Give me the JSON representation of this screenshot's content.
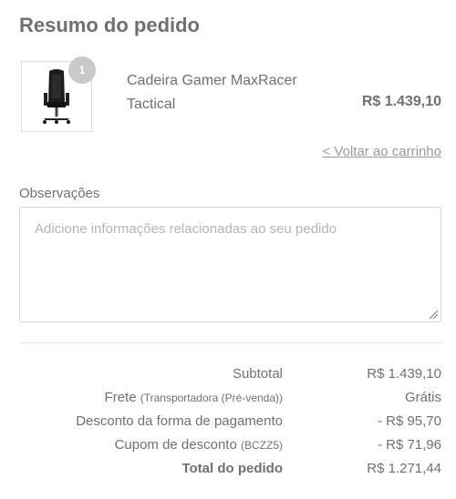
{
  "summary": {
    "title": "Resumo do pedido"
  },
  "product": {
    "icon": "gaming-chair-image",
    "quantity": "1",
    "name": "Cadeira Gamer MaxRacer Tactical",
    "price": "R$ 1.439,10"
  },
  "back_link": "< Voltar ao carrinho",
  "notes": {
    "label": "Observações",
    "placeholder": "Adicione informações relacionadas ao seu pedido",
    "value": ""
  },
  "totals": {
    "subtotal_label": "Subtotal",
    "subtotal_value": "R$ 1.439,10",
    "shipping_label": "Frete",
    "shipping_note": "(Transportadora (Pré-venda))",
    "shipping_value": "Grátis",
    "payment_discount_label": "Desconto da forma de pagamento",
    "payment_discount_value": "- R$ 95,70",
    "coupon_label": "Cupom de desconto",
    "coupon_code": "(BCZZ5)",
    "coupon_value": "- R$ 71,96",
    "total_label": "Total do pedido",
    "total_value": "R$ 1.271,44"
  }
}
